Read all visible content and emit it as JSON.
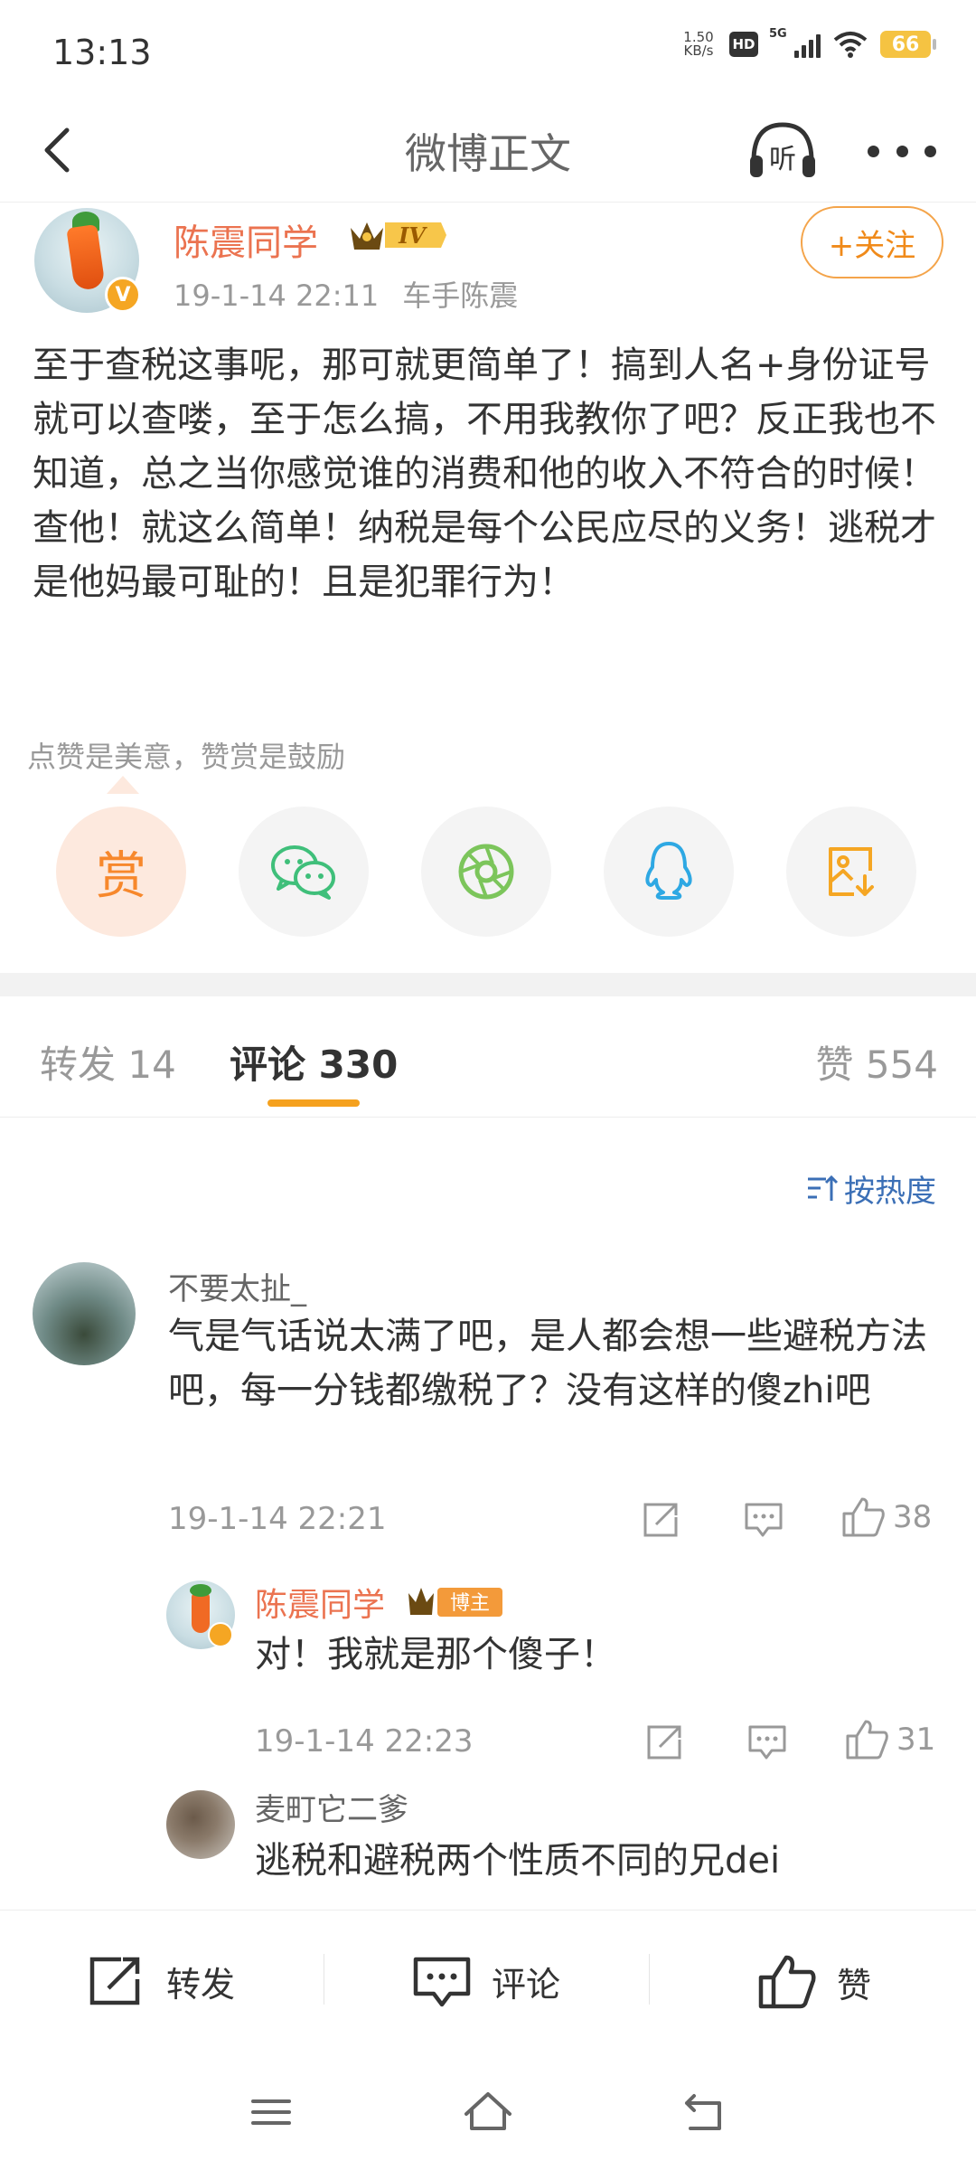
{
  "status": {
    "time": "13:13",
    "net_speed_value": "1.50",
    "net_speed_unit": "KB/s",
    "hd": "HD",
    "network": "5G",
    "battery": "66"
  },
  "nav": {
    "title": "微博正文",
    "listen_label": "听"
  },
  "author": {
    "name": "陈震同学",
    "level_badge": "IV",
    "verified_mark": "V",
    "time": "19-1-14 22:11",
    "source": "车手陈震",
    "follow_label": "+关注"
  },
  "post": {
    "text": "至于查税这事呢，那可就更简单了！搞到人名+身份证号就可以查喽，至于怎么搞，不用我教你了吧？反正我也不知道，总之当你感觉谁的消费和他的收入不符合的时候！查他！就这么简单！纳税是每个公民应尽的义务！逃税才是他妈最可耻的！且是犯罪行为！"
  },
  "reward": {
    "hint": "点赞是美意，赞赏是鼓励",
    "reward_label": "赏"
  },
  "share_icons": [
    "reward-icon",
    "wechat-icon",
    "moments-icon",
    "qq-icon",
    "save-image-icon"
  ],
  "tabs": {
    "repost": "转发 14",
    "comments": "评论 330",
    "likes": "赞 554"
  },
  "sort": {
    "label": "按热度"
  },
  "comments": [
    {
      "name": "不要太扯_",
      "text": "气是气话说太满了吧，是人都会想一些避税方法吧，每一分钱都缴税了？没有这样的傻zhi吧",
      "time": "19-1-14 22:21",
      "likes": "38"
    },
    {
      "name": "陈震同学",
      "badge": "博主",
      "text": "对！我就是那个傻子！",
      "time": "19-1-14 22:23",
      "likes": "31"
    },
    {
      "name": "麦町它二爹",
      "text": "逃税和避税两个性质不同的兄dei"
    }
  ],
  "bottom_bar": {
    "repost": "转发",
    "comment": "评论",
    "like": "赞"
  },
  "colors": {
    "accent_orange": "#eb7350",
    "tab_indicator": "#f5a11e",
    "link_blue": "#3b6fb6"
  }
}
